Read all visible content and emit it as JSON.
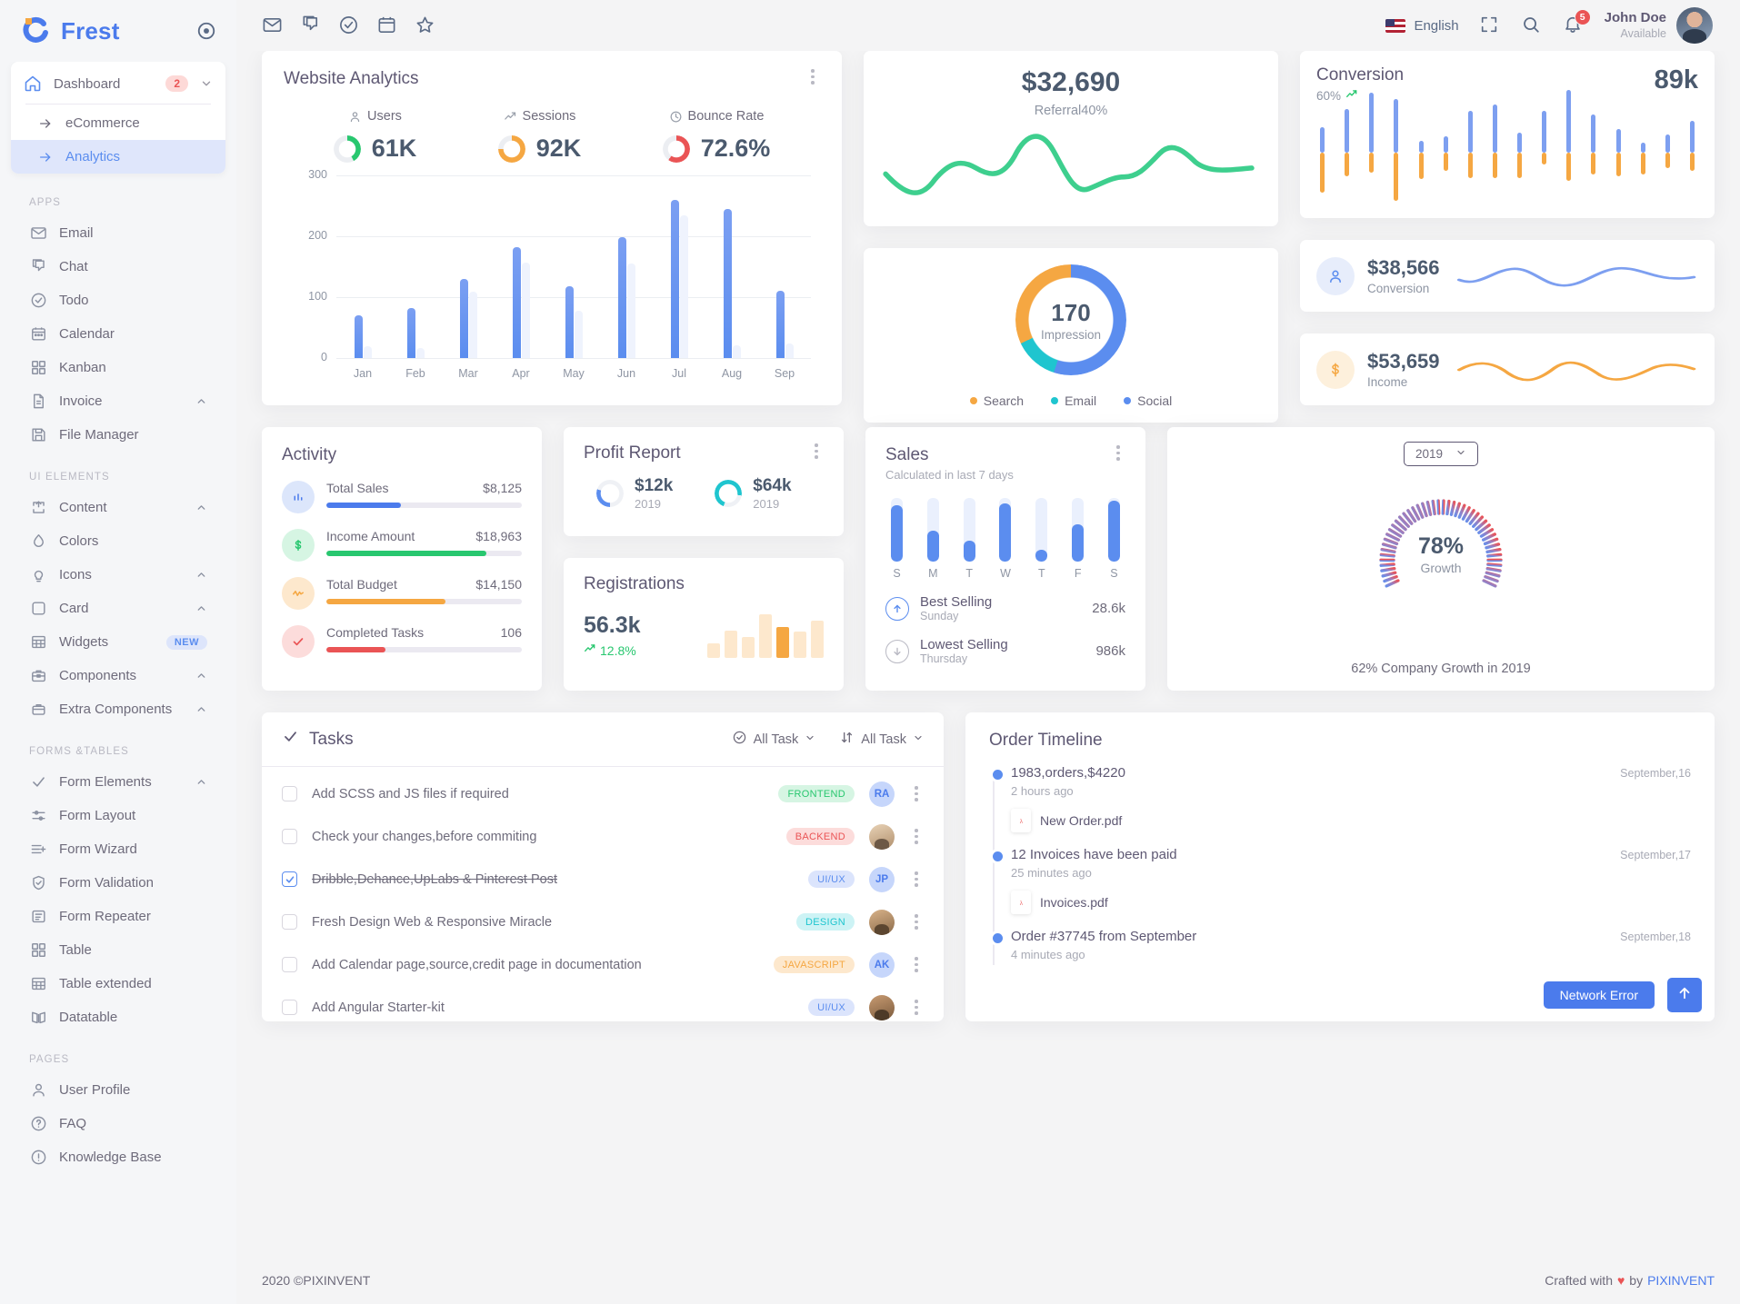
{
  "brand": {
    "name": "Frest",
    "logo_icon": "frest-logo-icon",
    "pin_icon": "circle-pin-icon"
  },
  "sidebar": {
    "dashboard": {
      "label": "Dashboard",
      "badge": "2",
      "icon": "home-icon",
      "chevron": "chevron-down-icon",
      "children": [
        {
          "label": "eCommerce",
          "icon": "arrow-right-icon",
          "active": false
        },
        {
          "label": "Analytics",
          "icon": "arrow-right-icon",
          "active": true
        }
      ]
    },
    "sections": [
      {
        "title": "APPS",
        "items": [
          {
            "label": "Email",
            "icon": "mail-icon",
            "chevron": "",
            "badge": ""
          },
          {
            "label": "Chat",
            "icon": "chat-icon",
            "chevron": "",
            "badge": ""
          },
          {
            "label": "Todo",
            "icon": "check-circle-icon",
            "chevron": "",
            "badge": ""
          },
          {
            "label": "Calendar",
            "icon": "calendar-icon",
            "chevron": "",
            "badge": ""
          },
          {
            "label": "Kanban",
            "icon": "grid-icon",
            "chevron": "",
            "badge": ""
          },
          {
            "label": "Invoice",
            "icon": "file-text-icon",
            "chevron": "chevron-up-icon",
            "badge": ""
          },
          {
            "label": "File Manager",
            "icon": "save-icon",
            "chevron": "",
            "badge": ""
          }
        ]
      },
      {
        "title": "UI ELEMENTS",
        "items": [
          {
            "label": "Content",
            "icon": "content-icon",
            "chevron": "chevron-up-icon",
            "badge": ""
          },
          {
            "label": "Colors",
            "icon": "droplet-icon",
            "chevron": "",
            "badge": ""
          },
          {
            "label": "Icons",
            "icon": "bulb-icon",
            "chevron": "chevron-up-icon",
            "badge": ""
          },
          {
            "label": "Card",
            "icon": "square-icon",
            "chevron": "chevron-up-icon",
            "badge": ""
          },
          {
            "label": "Widgets",
            "icon": "table-icon",
            "chevron": "",
            "badge": "NEW"
          },
          {
            "label": "Components",
            "icon": "briefcase-icon",
            "chevron": "chevron-up-icon",
            "badge": ""
          },
          {
            "label": "Extra Components",
            "icon": "toolbox-icon",
            "chevron": "chevron-up-icon",
            "badge": ""
          }
        ]
      },
      {
        "title": "FORMS &TABLES",
        "items": [
          {
            "label": "Form Elements",
            "icon": "check-icon",
            "chevron": "chevron-up-icon",
            "badge": ""
          },
          {
            "label": "Form Layout",
            "icon": "sliders-icon",
            "chevron": "",
            "badge": ""
          },
          {
            "label": "Form Wizard",
            "icon": "list-plus-icon",
            "chevron": "",
            "badge": ""
          },
          {
            "label": "Form Validation",
            "icon": "shield-check-icon",
            "chevron": "",
            "badge": ""
          },
          {
            "label": "Form Repeater",
            "icon": "form-repeater-icon",
            "chevron": "",
            "badge": ""
          },
          {
            "label": "Table",
            "icon": "grid-icon",
            "chevron": "",
            "badge": ""
          },
          {
            "label": "Table extended",
            "icon": "table-icon",
            "chevron": "",
            "badge": ""
          },
          {
            "label": "Datatable",
            "icon": "book-icon",
            "chevron": "",
            "badge": ""
          }
        ]
      },
      {
        "title": "PAGES",
        "items": [
          {
            "label": "User Profile",
            "icon": "user-icon",
            "chevron": "",
            "badge": ""
          },
          {
            "label": "FAQ",
            "icon": "help-circle-icon",
            "chevron": "",
            "badge": ""
          },
          {
            "label": "Knowledge Base",
            "icon": "info-circle-icon",
            "chevron": "",
            "badge": ""
          }
        ]
      }
    ]
  },
  "topbar": {
    "icons": [
      "mail-icon",
      "chat-icon",
      "check-circle-icon",
      "calendar-icon",
      "star-icon"
    ],
    "language": "English",
    "flag": "us-flag-icon",
    "fullscreen_icon": "fullscreen-icon",
    "search_icon": "search-icon",
    "bell_icon": "bell-icon",
    "notification_count": "5",
    "user_name": "John Doe",
    "user_status": "Available",
    "avatar": "user-avatar"
  },
  "analytics": {
    "title": "Website Analytics",
    "menu_icon": "more-vertical-icon",
    "metrics": [
      {
        "label": "Users",
        "icon": "user-icon",
        "value": "61K",
        "color": "#28c76f",
        "pct": 42
      },
      {
        "label": "Sessions",
        "icon": "trending-up-icon",
        "value": "92K",
        "color": "#f5a742",
        "pct": 75
      },
      {
        "label": "Bounce Rate",
        "icon": "clock-icon",
        "value": "72.6%",
        "color": "#ea5455",
        "pct": 60
      }
    ]
  },
  "chart_data": [
    {
      "type": "bar",
      "title": "Website Analytics",
      "categories": [
        "Jan",
        "Feb",
        "Mar",
        "Apr",
        "May",
        "Jun",
        "Jul",
        "Aug",
        "Sep"
      ],
      "series": [
        {
          "name": "current",
          "values": [
            80,
            94,
            147,
            207,
            133,
            225,
            295,
            277,
            125
          ]
        },
        {
          "name": "previous",
          "values": [
            22,
            18,
            123,
            177,
            88,
            176,
            265,
            24,
            28
          ]
        }
      ],
      "ylabel": "",
      "xlabel": "",
      "yticks": [
        0,
        100,
        200,
        300
      ],
      "ylim": [
        0,
        340
      ],
      "grid": true,
      "legend": "none"
    },
    {
      "type": "line",
      "title": "Referral",
      "value": "$32,690",
      "subtitle": "Referral40%",
      "color": "#28c76f",
      "points": [
        50,
        78,
        40,
        58,
        62,
        20,
        74,
        45,
        58,
        52,
        30,
        48,
        44,
        46
      ]
    },
    {
      "type": "bar",
      "title": "Conversion",
      "value": "89k",
      "subtitle": "60%",
      "up_values": [
        30,
        52,
        72,
        64,
        14,
        20,
        50,
        58,
        24,
        50,
        75,
        46,
        28,
        12,
        22,
        38
      ],
      "down_values": [
        48,
        28,
        24,
        58,
        32,
        22,
        30,
        30,
        30,
        14,
        34,
        26,
        28,
        26,
        18,
        22
      ],
      "up_color": "#7d9ff0",
      "down_color": "#f5a742"
    },
    {
      "type": "pie",
      "title": "Impression",
      "center_value": "170",
      "center_label": "Impression",
      "labels": [
        "Search",
        "Email",
        "Social"
      ],
      "values": [
        32,
        13,
        55
      ],
      "colors": [
        "#f5a742",
        "#1fc5cf",
        "#5b8def"
      ]
    },
    {
      "type": "line",
      "title": "Conversion",
      "value": "$38,566",
      "color": "#5b8def",
      "points": [
        42,
        30,
        52,
        60,
        38,
        30,
        50,
        58,
        48
      ]
    },
    {
      "type": "line",
      "title": "Income",
      "value": "$53,659",
      "color": "#f5a742",
      "points": [
        50,
        62,
        34,
        40,
        60,
        46,
        30,
        52,
        44
      ]
    },
    {
      "type": "bar",
      "title": "Registrations",
      "values": [
        30,
        58,
        44,
        92,
        66,
        56,
        78
      ],
      "highlight_index": 4,
      "color": "#fde8cd",
      "highlight_color": "#f5a742"
    },
    {
      "type": "bar",
      "title": "Sales",
      "categories": [
        "S",
        "M",
        "T",
        "W",
        "T",
        "F",
        "S"
      ],
      "values": [
        88,
        48,
        33,
        92,
        18,
        58,
        96
      ],
      "color": "#5b8def"
    },
    {
      "type": "gauge",
      "title": "Growth",
      "value": 78,
      "display": "78%",
      "label": "Growth",
      "caption": "62% Company Growth in 2019"
    }
  ],
  "referral": {
    "value": "$32,690",
    "label": "Referral40%"
  },
  "conversion_card": {
    "title": "Conversion",
    "pct": "60%",
    "value": "89k",
    "trend_icon": "trending-up-icon"
  },
  "impression": {
    "value": "170",
    "label": "Impression",
    "legend": [
      {
        "label": "Search",
        "color": "#f5a742"
      },
      {
        "label": "Email",
        "color": "#1fc5cf"
      },
      {
        "label": "Social",
        "color": "#5b8def"
      }
    ]
  },
  "mini_cards": [
    {
      "value": "$38,566",
      "label": "Conversion",
      "icon": "user-icon",
      "icon_bg": "#e7edfb",
      "icon_color": "#5b8def",
      "spark_color": "#5b8def"
    },
    {
      "value": "$53,659",
      "label": "Income",
      "icon": "dollar-icon",
      "icon_bg": "#fdf0dc",
      "icon_color": "#f5a742",
      "spark_color": "#f5a742"
    }
  ],
  "activity": {
    "title": "Activity",
    "rows": [
      {
        "label": "Total Sales",
        "value": "$8,125",
        "pct": 38,
        "color": "#4b7bec",
        "bg": "#dce6fb",
        "icon": "bar-chart-icon"
      },
      {
        "label": "Income Amount",
        "value": "$18,963",
        "pct": 82,
        "color": "#28c76f",
        "bg": "#d6f5e3",
        "icon": "dollar-icon"
      },
      {
        "label": "Total Budget",
        "value": "$14,150",
        "pct": 61,
        "color": "#f5a742",
        "bg": "#fde8cd",
        "icon": "activity-icon"
      },
      {
        "label": "Completed Tasks",
        "value": "106",
        "pct": 30,
        "color": "#ea5455",
        "bg": "#fcdcdb",
        "icon": "check-icon"
      }
    ]
  },
  "profit_report": {
    "title": "Profit Report",
    "menu_icon": "more-vertical-icon",
    "items": [
      {
        "value": "$12k",
        "year": "2019",
        "color": "#5b8def",
        "pct": 30
      },
      {
        "value": "$64k",
        "year": "2019",
        "color": "#1fc5cf",
        "pct": 72
      }
    ]
  },
  "registrations": {
    "title": "Registrations",
    "value": "56.3k",
    "delta": "12.8%",
    "delta_icon": "trending-up-icon"
  },
  "sales": {
    "title": "Sales",
    "subtitle": "Calculated in last 7 days",
    "menu_icon": "more-vertical-icon",
    "days": [
      "S",
      "M",
      "T",
      "W",
      "T",
      "F",
      "S"
    ],
    "values": [
      88,
      48,
      33,
      92,
      18,
      58,
      96
    ],
    "rows": [
      {
        "title": "Best Selling",
        "sub": "Sunday",
        "value": "28.6k",
        "icon": "arrow-up-circle-icon",
        "active": true
      },
      {
        "title": "Lowest Selling",
        "sub": "Thursday",
        "value": "986k",
        "icon": "arrow-down-circle-icon",
        "active": false
      }
    ]
  },
  "growth": {
    "year": "2019",
    "chevron_icon": "chevron-down-icon",
    "value": "78%",
    "label": "Growth",
    "caption": "62% Company Growth in 2019"
  },
  "tasks": {
    "title": "Tasks",
    "title_icon": "check-icon",
    "filter_1": {
      "label": "All Task",
      "icon": "check-circle-icon",
      "chevron": "chevron-down-icon"
    },
    "filter_2": {
      "label": "All Task",
      "icon": "sort-icon",
      "chevron": "chevron-down-icon"
    },
    "menu_icon": "more-vertical-icon",
    "rows": [
      {
        "text": "Add SCSS and JS files if required",
        "done": false,
        "chip": "FRONTEND",
        "chip_bg": "#d6f5e3",
        "chip_fg": "#28c76f",
        "avatar_type": "initials",
        "initials": "RA",
        "av_bg": "#c6d6fb",
        "av_fg": "#4b7bec"
      },
      {
        "text": "Check your changes,before commiting",
        "done": false,
        "chip": "BACKEND",
        "chip_bg": "#fcdcdb",
        "chip_fg": "#ea5455",
        "avatar_type": "photo",
        "initials": "",
        "av_bg": "#d8c3a8",
        "av_fg": "#fff"
      },
      {
        "text": "Dribble,Dehance,UpLabs & Pinterest Post",
        "done": true,
        "chip": "UI/UX",
        "chip_bg": "#dbe4fc",
        "chip_fg": "#5b8def",
        "avatar_type": "initials",
        "initials": "JP",
        "av_bg": "#c6d6fb",
        "av_fg": "#4b7bec"
      },
      {
        "text": "Fresh Design Web & Responsive Miracle",
        "done": false,
        "chip": "DESIGN",
        "chip_bg": "#cdf3f5",
        "chip_fg": "#1fc5cf",
        "avatar_type": "photo",
        "initials": "",
        "av_bg": "#b89a7c",
        "av_fg": "#fff"
      },
      {
        "text": "Add Calendar page,source,credit page in documentation",
        "done": false,
        "chip": "JAVASCRIPT",
        "chip_bg": "#fdе8cd",
        "chip_fg": "#f5a742",
        "avatar_type": "initials",
        "initials": "AK",
        "av_bg": "#c6d6fb",
        "av_fg": "#4b7bec"
      },
      {
        "text": "Add Angular Starter-kit",
        "done": false,
        "chip": "UI/UX",
        "chip_bg": "#dbe4fc",
        "chip_fg": "#5b8def",
        "avatar_type": "photo",
        "initials": "",
        "av_bg": "#a07c5c",
        "av_fg": "#fff"
      }
    ]
  },
  "timeline": {
    "title": "Order Timeline",
    "items": [
      {
        "title": "1983,orders,$4220",
        "time": "2 hours ago",
        "date": "September,16",
        "file": "New Order.pdf"
      },
      {
        "title": "12 Invoices have been paid",
        "time": "25 minutes ago",
        "date": "September,17",
        "file": "Invoices.pdf"
      },
      {
        "title": "Order #37745 from September",
        "time": "4 minutes ago",
        "date": "September,18",
        "file": ""
      }
    ]
  },
  "overlay": {
    "network_error": "Network Error",
    "scroll_top_icon": "arrow-up-icon"
  },
  "footer": {
    "left": "2020 ©PIXINVENT",
    "crafted": "Crafted with",
    "by": "by",
    "brand": "PIXINVENT",
    "heart": "♥"
  }
}
